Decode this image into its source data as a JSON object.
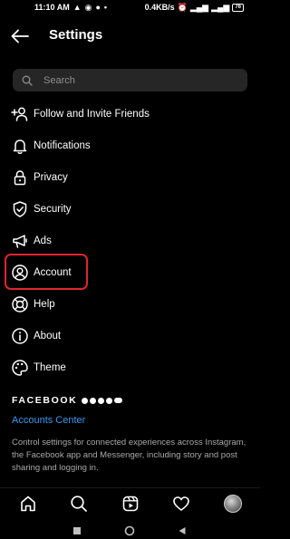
{
  "statusbar": {
    "time": "11:10 AM",
    "network_speed": "0.4KB/s",
    "battery": "76"
  },
  "header": {
    "title": "Settings"
  },
  "search": {
    "placeholder": "Search"
  },
  "menu": {
    "items": [
      {
        "label": "Follow and Invite Friends",
        "icon": "add-person-icon"
      },
      {
        "label": "Notifications",
        "icon": "bell-icon"
      },
      {
        "label": "Privacy",
        "icon": "lock-icon"
      },
      {
        "label": "Security",
        "icon": "shield-check-icon"
      },
      {
        "label": "Ads",
        "icon": "megaphone-icon"
      },
      {
        "label": "Account",
        "icon": "user-circle-icon"
      },
      {
        "label": "Help",
        "icon": "lifebuoy-icon"
      },
      {
        "label": "About",
        "icon": "info-icon"
      },
      {
        "label": "Theme",
        "icon": "palette-icon"
      }
    ]
  },
  "facebook": {
    "heading": "FACEBOOK",
    "link": "Accounts Center",
    "description": "Control settings for connected experiences across Instagram, the Facebook app and Messenger, including story and post sharing and logging in."
  },
  "bottomnav": {
    "items": [
      "home-icon",
      "search-icon",
      "reels-icon",
      "heart-icon",
      "profile-avatar"
    ]
  },
  "colors": {
    "background": "#000000",
    "link": "#3b97f0",
    "highlight": "#e0262e",
    "search_bg": "#262626"
  }
}
